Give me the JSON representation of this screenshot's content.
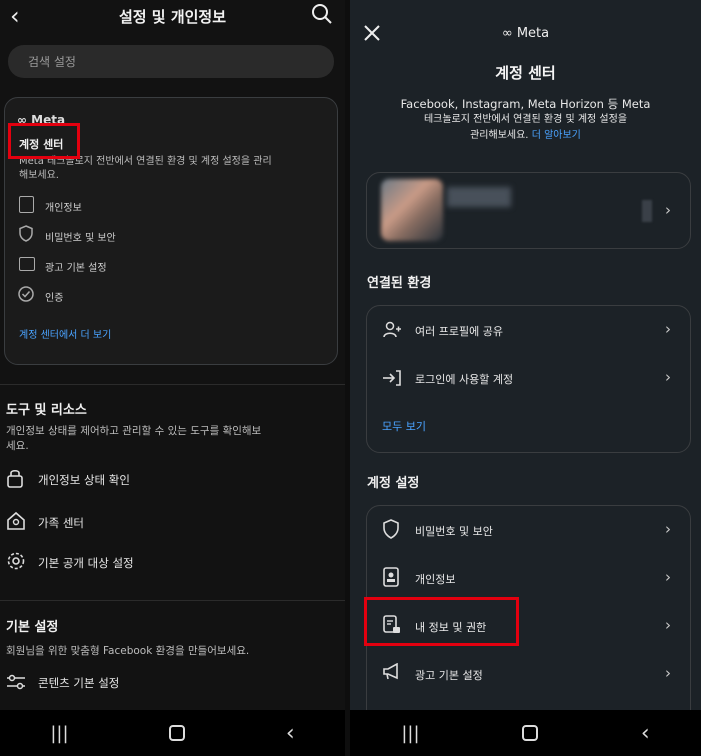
{
  "left": {
    "title": "설정 및 개인정보",
    "search_placeholder": "검색 설정",
    "meta_brand": "∞ Meta",
    "account_center_label": "계정 센터",
    "account_center_desc": "Meta 테크놀로지 전반에서 연결된 환경 및 계정 설정을 관리해보세요.",
    "items": [
      "개인정보",
      "비밀번호 및 보안",
      "광고 기본 설정",
      "인증"
    ],
    "more_link": "계정 센터에서 더 보기",
    "tools_heading": "도구 및 리소스",
    "tools_desc": "개인정보 상태를 제어하고 관리할 수 있는 도구를 확인해보세요.",
    "tools": [
      "개인정보 상태 확인",
      "가족 센터",
      "기본 공개 대상 설정"
    ],
    "prefs_heading": "기본 설정",
    "prefs_desc": "회원님을 위한 맞춤형 Facebook 환경을 만들어보세요.",
    "prefs": [
      "콘텐츠 기본 설정"
    ]
  },
  "right": {
    "meta_brand": "∞ Meta",
    "title": "계정 센터",
    "desc_line1": "Facebook, Instagram, Meta Horizon 등 Meta",
    "desc_line2": "테크놀로지 전반에서 연결된 환경 및 계정 설정을",
    "desc_line3": "관리해보세요.",
    "learn_more": "더 알아보기",
    "connected_heading": "연결된 환경",
    "connected_items": [
      "여러 프로필에 공유",
      "로그인에 사용할 계정"
    ],
    "see_all": "모두 보기",
    "settings_heading": "계정 설정",
    "settings_items": [
      "비밀번호 및 보안",
      "개인정보",
      "내 정보 및 권한",
      "광고 기본 설정"
    ]
  },
  "colors": {
    "highlight": "#e3000f",
    "link": "#4aa3ff"
  }
}
